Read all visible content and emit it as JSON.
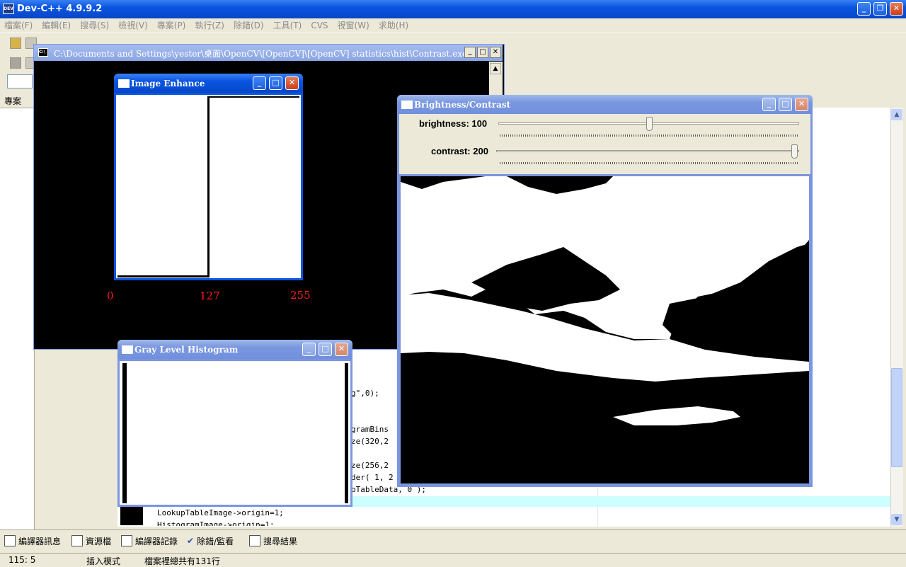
{
  "ide": {
    "title": "Dev-C++ 4.9.9.2",
    "menu": [
      "檔案(F)",
      "編輯(E)",
      "搜尋(S)",
      "檢視(V)",
      "專案(P)",
      "執行(Z)",
      "除錯(D)",
      "工具(T)",
      "CVS",
      "視窗(W)",
      "求助(H)"
    ],
    "project_tab": "專案",
    "bottom_tabs": [
      "編譯器訊息",
      "資源檔",
      "編譯器記錄",
      "除錯/監看",
      "搜尋結果"
    ],
    "status": {
      "position": "115: 5",
      "mode": "插入模式",
      "lines": "檔案裡總共有131行"
    },
    "code_lines": [
      {
        "text": "g\",0);"
      },
      {
        "text": "gramBins"
      },
      {
        "text": "ze(320,2"
      },
      {
        "text": "ze(256,2"
      },
      {
        "text": "der( 1, 2"
      },
      {
        "text": "pTableData, 0 );"
      },
      {
        "text": "LookupTableImage->origin=1;"
      },
      {
        "text": "HistogramImage->origin=1;"
      }
    ]
  },
  "console": {
    "title": "C:\\Documents and Settings\\yester\\桌面\\OpenCV\\[OpenCV]\\[OpenCV] statistics\\hist\\Contrast.exe"
  },
  "enhance": {
    "title": "Image Enhance",
    "axis_labels": [
      "0",
      "127",
      "255"
    ]
  },
  "histogram": {
    "title": "Gray Level Histogram"
  },
  "bc": {
    "title": "Brightness/Contrast",
    "brightness_label": "brightness: 100",
    "contrast_label": "contrast: 200",
    "brightness_value": 100,
    "brightness_max": 200,
    "contrast_value": 200,
    "contrast_max": 200
  },
  "colors": {
    "axis_label": "#ff1a1a",
    "selection_line": "#ccffff"
  }
}
